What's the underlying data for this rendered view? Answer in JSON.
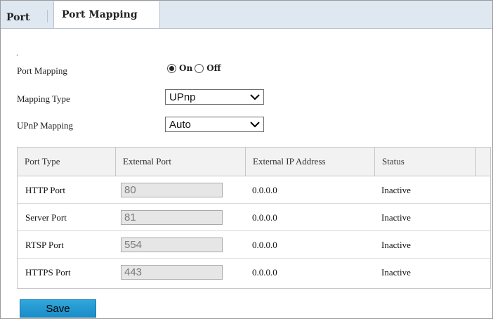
{
  "tabs": {
    "port": "Port",
    "port_mapping": "Port Mapping"
  },
  "top_dot": ".",
  "form": {
    "port_mapping_label": "Port Mapping",
    "on_label": "On",
    "off_label": "Off",
    "selected": "On",
    "mapping_type_label": "Mapping Type",
    "mapping_type_value": "UPnp",
    "upnp_mapping_label": "UPnP Mapping",
    "upnp_mapping_value": "Auto"
  },
  "table": {
    "headers": [
      "Port Type",
      "External Port",
      "External IP Address",
      "Status"
    ],
    "rows": [
      {
        "type": "HTTP Port",
        "port": "80",
        "ip": "0.0.0.0",
        "status": "Inactive"
      },
      {
        "type": "Server Port",
        "port": "81",
        "ip": "0.0.0.0",
        "status": "Inactive"
      },
      {
        "type": "RTSP Port",
        "port": "554",
        "ip": "0.0.0.0",
        "status": "Inactive"
      },
      {
        "type": "HTTPS Port",
        "port": "443",
        "ip": "0.0.0.0",
        "status": "Inactive"
      }
    ]
  },
  "save_label": "Save",
  "colors": {
    "tab_bar": "#dfe7f0",
    "save_button": "#1e94cf",
    "table_header": "#f2f2f2"
  },
  "icons": {
    "select_arrow": "chevron-down-icon"
  }
}
